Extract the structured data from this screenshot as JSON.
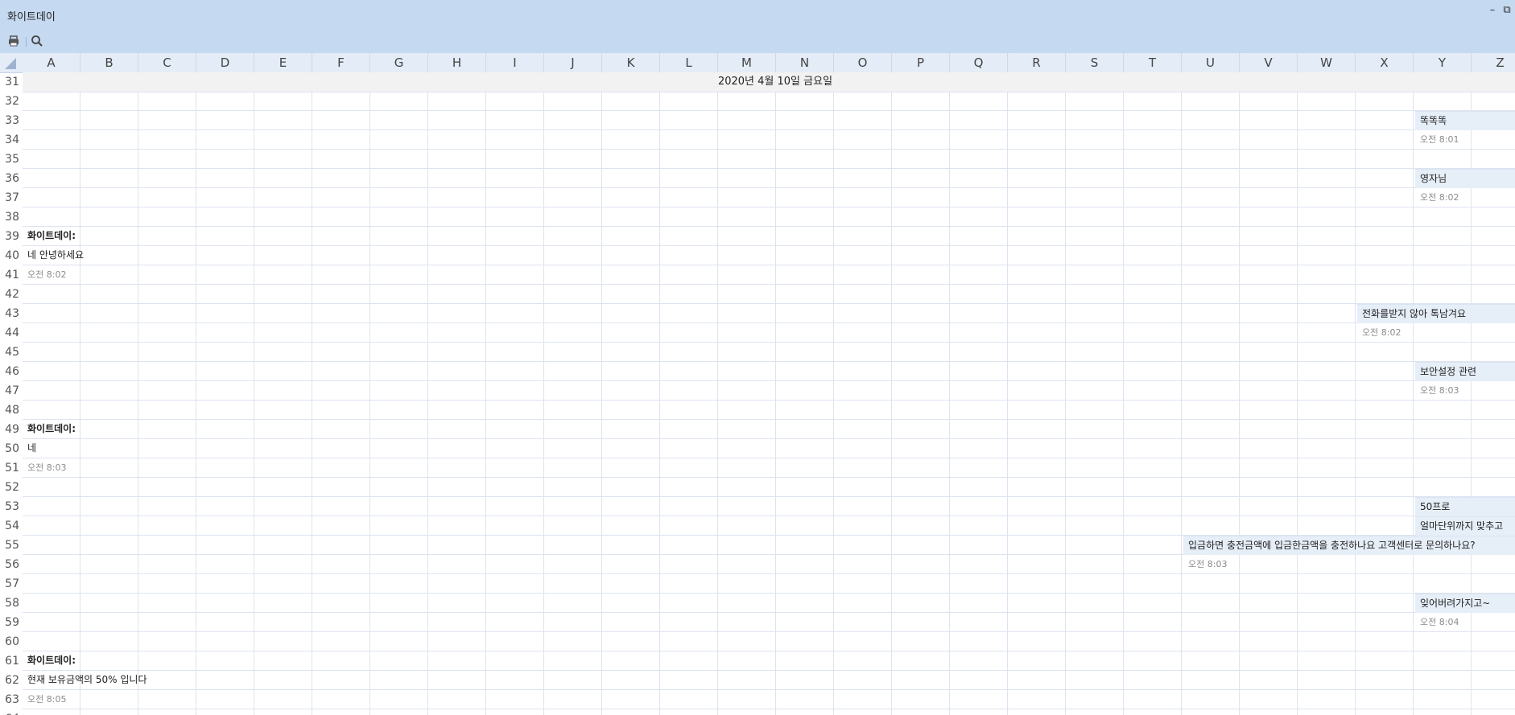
{
  "window": {
    "title": "화이트데이"
  },
  "win_controls": {
    "minimize": "–",
    "restore": "⧉"
  },
  "columns": [
    "A",
    "B",
    "C",
    "D",
    "E",
    "F",
    "G",
    "H",
    "I",
    "J",
    "K",
    "L",
    "M",
    "N",
    "O",
    "P",
    "Q",
    "R",
    "S",
    "T",
    "U",
    "V",
    "W",
    "X",
    "Y",
    "Z"
  ],
  "rows": [
    "31",
    "32",
    "33",
    "34",
    "35",
    "36",
    "37",
    "38",
    "39",
    "40",
    "41",
    "42",
    "43",
    "44",
    "45",
    "46",
    "47",
    "48",
    "49",
    "50",
    "51",
    "52",
    "53",
    "54",
    "55",
    "56",
    "57",
    "58",
    "59",
    "60",
    "61",
    "62",
    "63",
    "64"
  ],
  "chat": {
    "date": "2020년 4월 10일 금요일",
    "messages": [
      {
        "text": "똑똑똑",
        "time": "오전 8:01"
      },
      {
        "text": "영자님",
        "time": "오전 8:02"
      },
      {
        "sender": "화이트데이:",
        "text": "네 안녕하세요",
        "time": "오전 8:02"
      },
      {
        "text": "전화를받지 않아 톡남겨요",
        "time": "오전 8:02"
      },
      {
        "text": "보안설정 관련",
        "time": "오전 8:03"
      },
      {
        "sender": "화이트데이:",
        "text": "네",
        "time": "오전 8:03"
      },
      {
        "text": "50프로"
      },
      {
        "text": "얼마단위까지 맞추고"
      },
      {
        "text": "입금하면 충전금액에 입금한금액을 충전하나요 고객센터로 문의하나요?",
        "time": "오전 8:03"
      },
      {
        "text": "잊어버려가지고~",
        "time": "오전 8:04"
      },
      {
        "sender": "화이트데이:",
        "text": "현재 보유금액의 50% 입니다",
        "time": "오전 8:05"
      }
    ]
  }
}
